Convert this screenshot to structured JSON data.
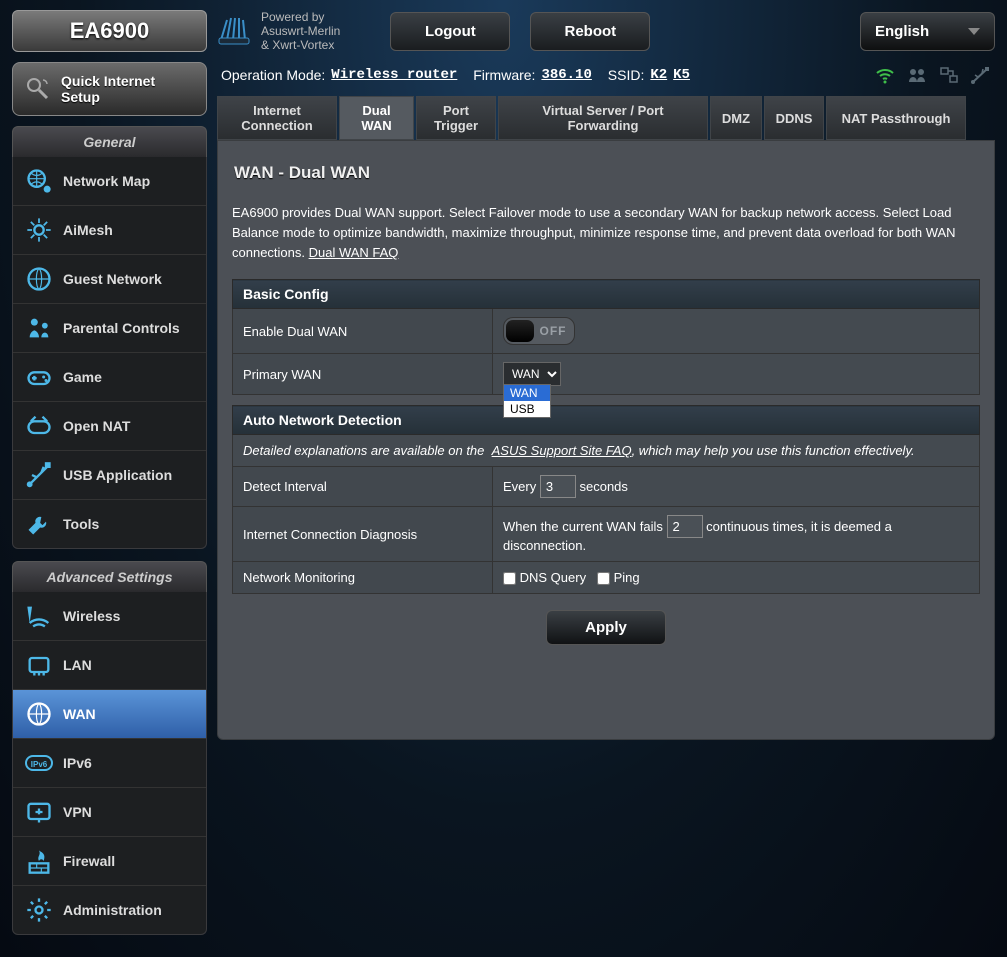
{
  "brand": {
    "model": "EA6900",
    "powered_line1": "Powered by",
    "powered_line2": "Asuswrt-Merlin",
    "powered_line3": "& Xwrt-Vortex"
  },
  "top_buttons": {
    "logout": "Logout",
    "reboot": "Reboot",
    "language": "English"
  },
  "status": {
    "op_mode_label": "Operation Mode:",
    "op_mode_value": "Wireless router",
    "fw_label": "Firmware:",
    "fw_value": "386.10",
    "ssid_label": "SSID:",
    "ssid1": "K2",
    "ssid2": "K5"
  },
  "quick_setup": {
    "line1": "Quick Internet",
    "line2": "Setup"
  },
  "menu": {
    "general_header": "General",
    "general": [
      "Network Map",
      "AiMesh",
      "Guest Network",
      "Parental Controls",
      "Game",
      "Open NAT",
      "USB Application",
      "Tools"
    ],
    "advanced_header": "Advanced Settings",
    "advanced": [
      "Wireless",
      "LAN",
      "WAN",
      "IPv6",
      "VPN",
      "Firewall",
      "Administration"
    ]
  },
  "tabs": [
    "Internet Connection",
    "Dual WAN",
    "Port Trigger",
    "Virtual Server / Port Forwarding",
    "DMZ",
    "DDNS",
    "NAT Passthrough"
  ],
  "page": {
    "title": "WAN - Dual WAN",
    "description": "EA6900 provides Dual WAN support. Select Failover mode to use a secondary WAN for backup network access. Select Load Balance mode to optimize bandwidth, maximize throughput, minimize response time, and prevent data overload for both WAN connections. ",
    "faq_link": "Dual WAN FAQ"
  },
  "basic": {
    "header": "Basic Config",
    "enable_label": "Enable Dual WAN",
    "enable_state": "OFF",
    "primary_label": "Primary WAN",
    "primary_value": "WAN",
    "primary_options": [
      "WAN",
      "USB"
    ]
  },
  "auto": {
    "header": "Auto Network Detection",
    "desc_prefix": "Detailed explanations are available on the ",
    "desc_link": "ASUS Support Site FAQ",
    "desc_suffix": ", which may help you use this function effectively.",
    "interval_label": "Detect Interval",
    "interval_prefix": "Every",
    "interval_value": "3",
    "interval_suffix": "seconds",
    "diag_label": "Internet Connection Diagnosis",
    "diag_prefix": "When the current WAN fails",
    "diag_value": "2",
    "diag_suffix": "continuous times, it is deemed a disconnection.",
    "netmon_label": "Network Monitoring",
    "netmon_opt1": "DNS Query",
    "netmon_opt2": "Ping"
  },
  "apply_label": "Apply"
}
